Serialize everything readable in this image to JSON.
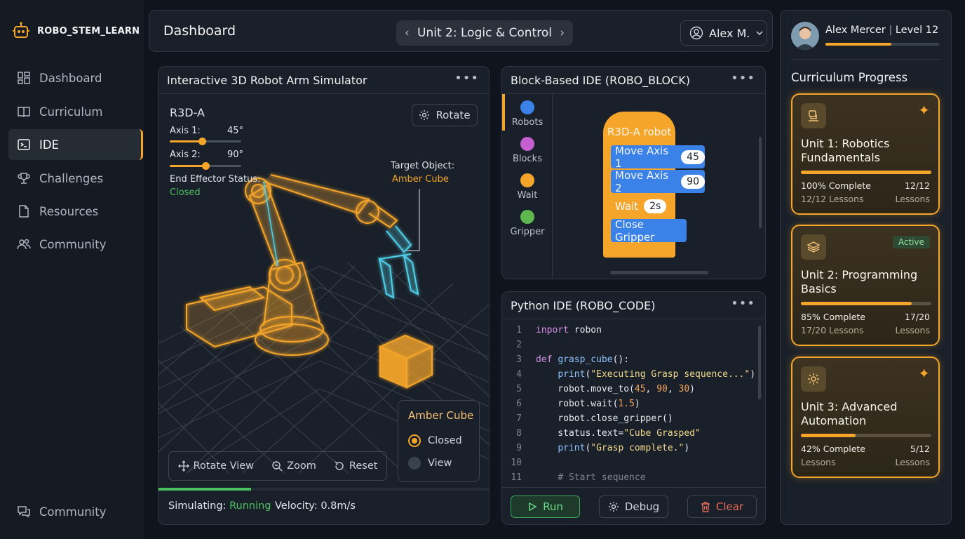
{
  "brand": {
    "name": "ROBO_STEM_LEARN"
  },
  "sidebar": {
    "items": [
      {
        "label": "Dashboard",
        "icon": "dashboard-icon"
      },
      {
        "label": "Curriculum",
        "icon": "book-icon"
      },
      {
        "label": "IDE",
        "icon": "terminal-icon",
        "active": true
      },
      {
        "label": "Challenges",
        "icon": "trophy-icon"
      },
      {
        "label": "Resources",
        "icon": "document-icon"
      },
      {
        "label": "Community",
        "icon": "people-icon"
      }
    ],
    "footer": {
      "label": "Community",
      "icon": "chat-icon"
    }
  },
  "header": {
    "title": "Dashboard",
    "unit": "Unit 2: Logic & Control",
    "user": "Alex M."
  },
  "simulator": {
    "title": "Interactive 3D Robot Arm Simulator",
    "robot_name": "R3D-A",
    "axis1": {
      "label": "Axis 1:",
      "value": "45°",
      "level": 0.45
    },
    "axis2": {
      "label": "Axis 2:",
      "value": "90°",
      "level": 0.5
    },
    "effector_label": "End Effector Status:",
    "effector_value": "Closed",
    "rotate_label": "Rotate",
    "target_label": "Target Object:",
    "target_value": "Amber Cube",
    "legend": {
      "title": "Amber Cube",
      "opt1": "Closed",
      "opt2": "View"
    },
    "toolbar": {
      "rotate_view": "Rotate View",
      "zoom": "Zoom",
      "reset": "Reset"
    },
    "status_label": "Simulating:",
    "status_value": "Running",
    "velocity": "Velocity: 0.8m/s",
    "progress": 0.28
  },
  "block_ide": {
    "title": "Block-Based IDE (ROBO_BLOCK)",
    "categories": [
      {
        "label": "Robots",
        "color": "#3b82e8"
      },
      {
        "label": "Blocks",
        "color": "#c45fcf"
      },
      {
        "label": "Wait",
        "color": "#f5a52a"
      },
      {
        "label": "Gripper",
        "color": "#5fb84f"
      }
    ],
    "hat": "R3D-A robot",
    "blocks": [
      {
        "text": "Move Axis 1",
        "value": "45"
      },
      {
        "text": "Move Axis 2",
        "value": "90"
      },
      {
        "text": "Wait",
        "value": "2s"
      },
      {
        "text": "Close Gripper",
        "value": ""
      }
    ]
  },
  "python_ide": {
    "title": "Python IDE (ROBO_CODE)",
    "lines": [
      "1",
      "2",
      "3",
      "4",
      "5",
      "6",
      "7",
      "8",
      "9",
      "10",
      "11"
    ],
    "run": "Run",
    "debug": "Debug",
    "clear": "Clear"
  },
  "profile": {
    "name": "Alex Mercer",
    "level": "Level 12",
    "xp": 0.58
  },
  "curriculum": {
    "title": "Curriculum Progress",
    "units": [
      {
        "title": "Unit 1: Robotics Fundamentals",
        "progress": 1.0,
        "complete": "100% Complete",
        "lessons": "12/12 Lessons",
        "count": "12/12",
        "count_label": "Lessons",
        "badge": ""
      },
      {
        "title": "Unit 2: Programming Basics",
        "progress": 0.85,
        "complete": "85% Complete",
        "lessons": "17/20 Lessons",
        "count": "17/20",
        "count_label": "Lessons",
        "badge": "Active"
      },
      {
        "title": "Unit 3: Advanced Automation",
        "progress": 0.42,
        "complete": "42% Complete",
        "lessons": "Lessons",
        "count": "5/12",
        "count_label": "Lessons",
        "badge": ""
      }
    ]
  }
}
